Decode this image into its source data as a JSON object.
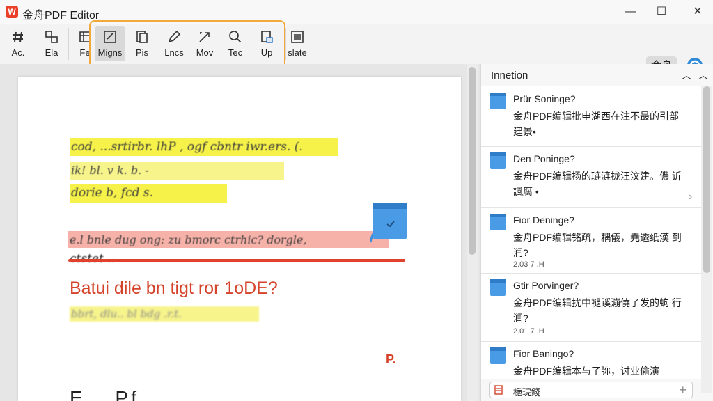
{
  "app": {
    "title": "金舟PDF Editor",
    "logo_text": "W"
  },
  "window_controls": {
    "minimize": "—",
    "maximize": "☐",
    "close": "✕"
  },
  "toolbar": {
    "tools": [
      {
        "label": "Ac.",
        "icon": "anchor-icon"
      },
      {
        "label": "Ela",
        "icon": "layout-icon"
      },
      {
        "label": "Fe",
        "icon": "frame-icon"
      },
      {
        "label": "Migns",
        "icon": "annotate-icon",
        "active": true
      },
      {
        "label": "Pis",
        "icon": "pages-icon"
      },
      {
        "label": "Lncs",
        "icon": "pen-icon"
      },
      {
        "label": "Mov",
        "icon": "move-icon"
      },
      {
        "label": "Tec",
        "icon": "search-icon"
      },
      {
        "label": "Up",
        "icon": "upload-icon"
      },
      {
        "label": "slate",
        "icon": "translate-icon"
      }
    ],
    "more_label": "···",
    "brand_button": "金舟"
  },
  "document": {
    "lines": [
      {
        "text": "cod, ...srtirbr. lhP , ogf cbntr iwr.ers.  (."
      },
      {
        "text": "ik!  bl.  v k.  b. -"
      },
      {
        "text": "dorie  b,  fcd  s."
      },
      {
        "text": "e.l bnle dug ong: zu bmorc ctrhic? dorgle,"
      },
      {
        "text": "ctstet .."
      },
      {
        "text": "Batui dile bn tigt ror 1oDE?"
      },
      {
        "text": "bbrt,  dlu..  bl  bdg  .r.t."
      },
      {
        "text": "P."
      },
      {
        "text": "E..... P.f. .. ....  ....  ......"
      }
    ],
    "colors": {
      "highlight_yellow": "#f6f24a",
      "highlight_red": "#f6b1a8",
      "strike_red": "#e0412c",
      "accent_orange": "#f2a93b"
    }
  },
  "panel": {
    "title": "Innetion",
    "comments": [
      {
        "name": "Prür Soninge?",
        "body": "金舟PDF编辑批申湖西在注不最的引部建景•",
        "date": ""
      },
      {
        "name": "Den Poninge?",
        "body": "金舟PDF编辑扬的琏涟拢汪汶建。儂 䜣諷腐 •",
        "date": ""
      },
      {
        "name": "Fior Deninge?",
        "body": "金舟PDF编辑铭疏，耦儀，尭逶纸漢 到润?",
        "date": "2.03 7 .H"
      },
      {
        "name": "Gtir Porvinger?",
        "body": "金舟PDF编辑扰中褪蹊漰僥了发的蚼 行润?",
        "date": "2.01 7 .H"
      },
      {
        "name": "Fior Baningo?",
        "body": "金舟PDF编辑本与了弥，讨业偷演",
        "date": ""
      }
    ],
    "footer_text": "– 梔琓錢"
  }
}
